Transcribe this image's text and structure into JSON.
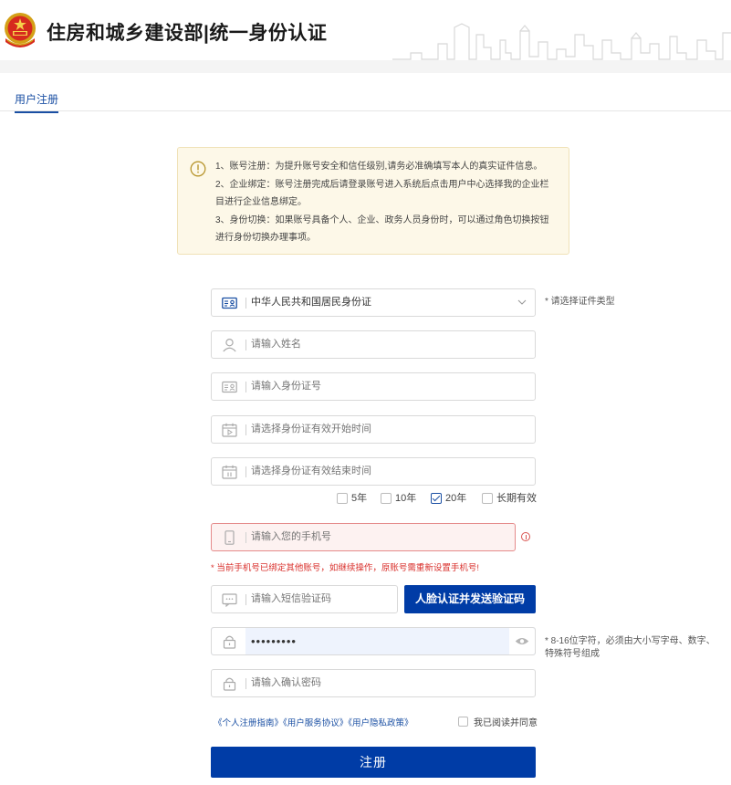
{
  "header": {
    "site_title": "住房和城乡建设部|统一身份认证"
  },
  "tabs": [
    {
      "label": "用户注册",
      "active": true
    }
  ],
  "notice": {
    "lines": [
      "1、账号注册：为提升账号安全和信任级别,请务必准确填写本人的真实证件信息。",
      "2、企业绑定：账号注册完成后请登录账号进入系统后点击用户中心选择我的企业栏目进行企业信息绑定。",
      "3、身份切换：如果账号具备个人、企业、政务人员身份时，可以通过角色切换按钮进行身份切换办理事项。"
    ]
  },
  "form": {
    "id_type": {
      "value": "中华人民共和国居民身份证",
      "hint": "* 请选择证件类型"
    },
    "name": {
      "placeholder": "请输入姓名"
    },
    "id_number": {
      "placeholder": "请输入身份证号"
    },
    "valid_start": {
      "placeholder": "请选择身份证有效开始时间"
    },
    "valid_end": {
      "placeholder": "请选择身份证有效结束时间"
    },
    "validity_options": [
      {
        "label": "5年",
        "checked": false
      },
      {
        "label": "10年",
        "checked": false
      },
      {
        "label": "20年",
        "checked": true
      },
      {
        "label": "长期有效",
        "checked": false
      }
    ],
    "phone": {
      "placeholder": "请输入您的手机号",
      "error": "* 当前手机号已绑定其他账号，如继续操作，原账号需重新设置手机号!"
    },
    "sms": {
      "placeholder": "请输入短信验证码",
      "button": "人脸认证并发送验证码"
    },
    "password": {
      "value": "•••••••••",
      "hint_line1": "* 8-16位字符，必须由大小写字母、数字、",
      "hint_line2": "特殊符号组成"
    },
    "confirm_password": {
      "placeholder": "请输入确认密码"
    },
    "links": [
      "《个人注册指南》",
      "《用户服务协议》",
      "《用户隐私政策》"
    ],
    "agree_label": "我已阅读并同意",
    "submit_label": "注册"
  },
  "colors": {
    "primary": "#003ca6",
    "link": "#1a4fa3",
    "error": "#d9302c",
    "notice_bg": "#fdf8e8"
  },
  "icons": [
    "national-emblem-icon",
    "warning-circle-icon",
    "id-card-icon",
    "user-icon",
    "calendar-icon",
    "phone-icon",
    "message-icon",
    "lock-icon",
    "eye-icon",
    "chevron-down-icon",
    "error-icon"
  ]
}
